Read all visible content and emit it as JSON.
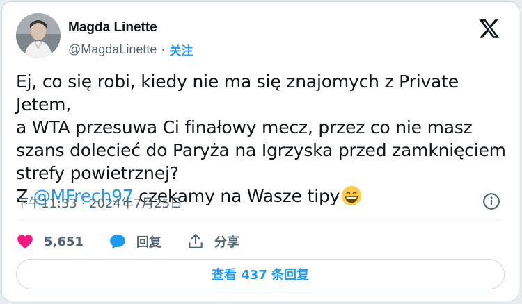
{
  "author": {
    "name": "Magda Linette",
    "handle": "@MagdaLinette",
    "separator": "·",
    "follow_label": "关注"
  },
  "tweet": {
    "line1": "Ej, co się robi, kiedy nie ma się znajomych z Private Jetem,",
    "line2": "a WTA przesuwa Ci finałowy mecz, przez co nie masz",
    "line3": "szans dolecieć do Paryża na Igrzyska przed zamknięciem",
    "line4": "strefy powietrznej?",
    "line5_prefix": "Z ",
    "mention": "@MFrech97",
    "line5_suffix": " czekamy na Wasze tipy",
    "emoji": "grinning-face-with-smiling-eyes"
  },
  "timestamp": "下午11:33 · 2024年7月25日",
  "actions": {
    "likes": "5,651",
    "reply_label": "回复",
    "share_label": "分享"
  },
  "replies_button": "查看 437 条回复",
  "colors": {
    "accent": "#1d9bf0",
    "like": "#f91880",
    "text": "#0f1419",
    "secondary": "#536471"
  }
}
